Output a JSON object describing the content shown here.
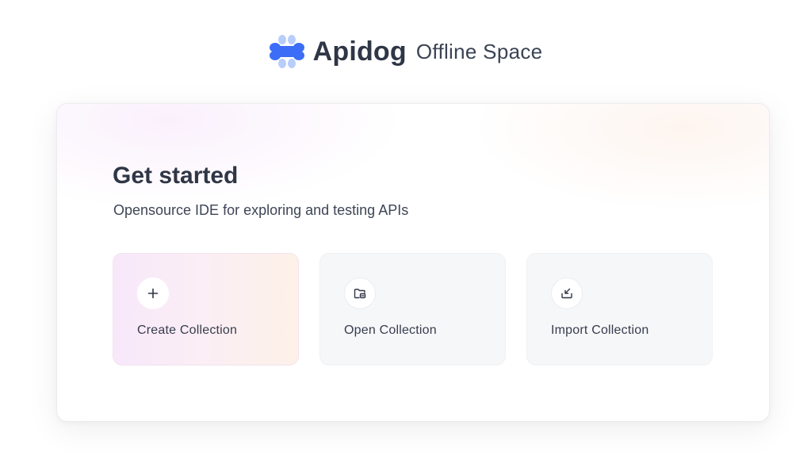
{
  "brand": {
    "name": "Apidog",
    "space": "Offline Space",
    "logo_icon": "apidog-logo-icon"
  },
  "card": {
    "title": "Get started",
    "subtitle": "Opensource IDE for exploring and testing APIs"
  },
  "actions": [
    {
      "label": "Create Collection",
      "icon": "plus-icon"
    },
    {
      "label": "Open Collection",
      "icon": "folder-open-icon"
    },
    {
      "label": "Import Collection",
      "icon": "import-icon"
    }
  ],
  "colors": {
    "logo_primary": "#3c6df6",
    "logo_secondary": "#a9c3fb",
    "text_dark": "#2f3646",
    "tile_bg": "#f6f7f9",
    "primary_tile_gradient_start": "#f8e8fb",
    "primary_tile_gradient_end": "#fdf1e8"
  }
}
